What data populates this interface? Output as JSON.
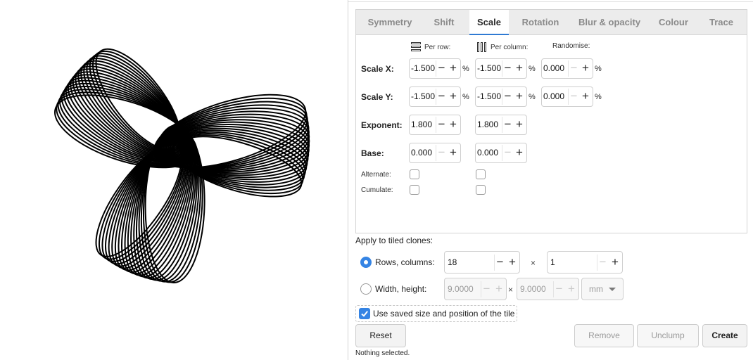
{
  "canvas": {
    "shape": "three-lobed spirograph-like clone pattern"
  },
  "tabs": [
    {
      "label": "Symmetry",
      "active": false
    },
    {
      "label": "Shift",
      "active": false
    },
    {
      "label": "Scale",
      "active": true
    },
    {
      "label": "Rotation",
      "active": false
    },
    {
      "label": "Blur & opacity",
      "active": false
    },
    {
      "label": "Colour",
      "active": false
    },
    {
      "label": "Trace",
      "active": false
    }
  ],
  "columns": {
    "per_row": "Per row:",
    "per_column": "Per column:",
    "randomise": "Randomise:"
  },
  "rows": {
    "scale_x": {
      "label": "Scale X:",
      "per_row": "-1.500",
      "per_column": "-1.500",
      "randomise": "0.000"
    },
    "scale_y": {
      "label": "Scale Y:",
      "per_row": "-1.500",
      "per_column": "-1.500",
      "randomise": "0.000"
    },
    "exponent": {
      "label": "Exponent:",
      "per_row": "1.800",
      "per_column": "1.800"
    },
    "base": {
      "label": "Base:",
      "per_row": "0.000",
      "per_column": "0.000"
    },
    "alternate": {
      "label": "Alternate:",
      "per_row": false,
      "per_column": false
    },
    "cumulate": {
      "label": "Cumulate:",
      "per_row": false,
      "per_column": false
    }
  },
  "percent": "%",
  "apply": {
    "label": "Apply to tiled clones:",
    "rows_columns": {
      "label": "Rows, columns:",
      "selected": true,
      "rows": "18",
      "columns": "1"
    },
    "width_height": {
      "label": "Width, height:",
      "selected": false,
      "width": "9.0000",
      "height": "9.0000",
      "unit": "mm"
    },
    "times": "×"
  },
  "use_saved": {
    "label": "Use saved size and position of the tile",
    "checked": true
  },
  "buttons": {
    "reset": "Reset",
    "remove": "Remove",
    "unclump": "Unclump",
    "create": "Create"
  },
  "status": "Nothing selected.",
  "colors": {
    "accent": "#3584e4",
    "tab_underline": "#2f7ad3",
    "shape": "#000000"
  }
}
